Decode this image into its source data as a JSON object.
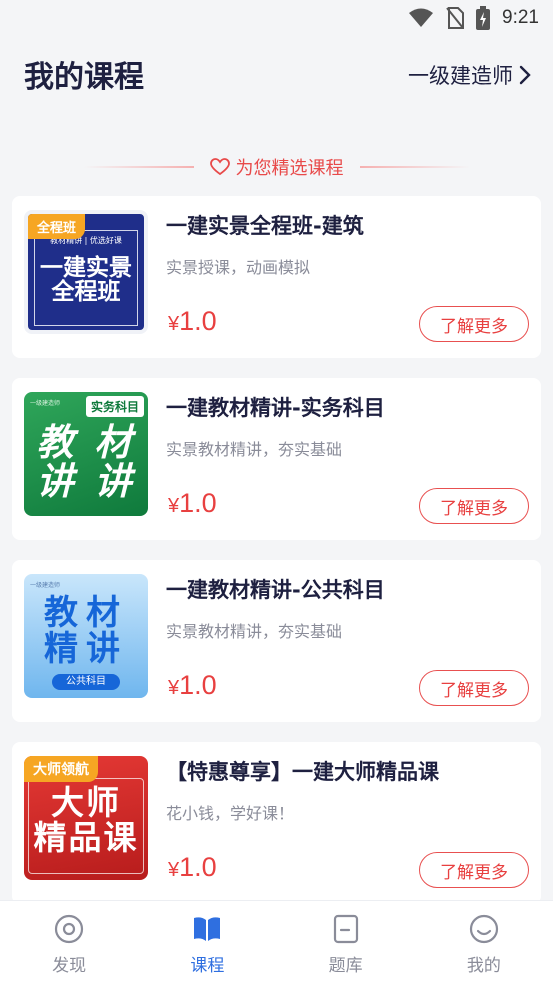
{
  "status_bar": {
    "time": "9:21"
  },
  "header": {
    "title": "我的课程",
    "category": "一级建造师"
  },
  "section": {
    "title": "为您精选课程"
  },
  "courses": [
    {
      "title": "一建实景全程班-建筑",
      "subtitle": "实景授课，动画模拟",
      "currency": "¥",
      "price": "1.0",
      "button": "了解更多",
      "thumb": {
        "badge": "全程班",
        "top": "教材精讲 | 优选好课",
        "main": "一建实景\n全程班"
      }
    },
    {
      "title": "一建教材精讲-实务科目",
      "subtitle": "实景教材精讲，夯实基础",
      "currency": "¥",
      "price": "1.0",
      "button": "了解更多",
      "thumb": {
        "badge": "实务科目",
        "top": "一级建造师",
        "main": "教 材\n讲 讲"
      }
    },
    {
      "title": "一建教材精讲-公共科目",
      "subtitle": "实景教材精讲，夯实基础",
      "currency": "¥",
      "price": "1.0",
      "button": "了解更多",
      "thumb": {
        "foot": "公共科目",
        "top": "一级建造师",
        "main": "教材\n精讲"
      }
    },
    {
      "title": "【特惠尊享】一建大师精品课",
      "subtitle": "花小钱，学好课！",
      "currency": "¥",
      "price": "1.0",
      "button": "了解更多",
      "thumb": {
        "badge": "大师领航",
        "main": "大师\n精品课"
      }
    }
  ],
  "tabs": [
    {
      "label": "发现",
      "icon": "eye-icon",
      "active": false
    },
    {
      "label": "课程",
      "icon": "book-icon",
      "active": true
    },
    {
      "label": "题库",
      "icon": "question-bank-icon",
      "active": false
    },
    {
      "label": "我的",
      "icon": "smiley-icon",
      "active": false
    }
  ],
  "colors": {
    "accent": "#2f6fe0",
    "price": "#e84040",
    "badge": "#f6a623"
  }
}
